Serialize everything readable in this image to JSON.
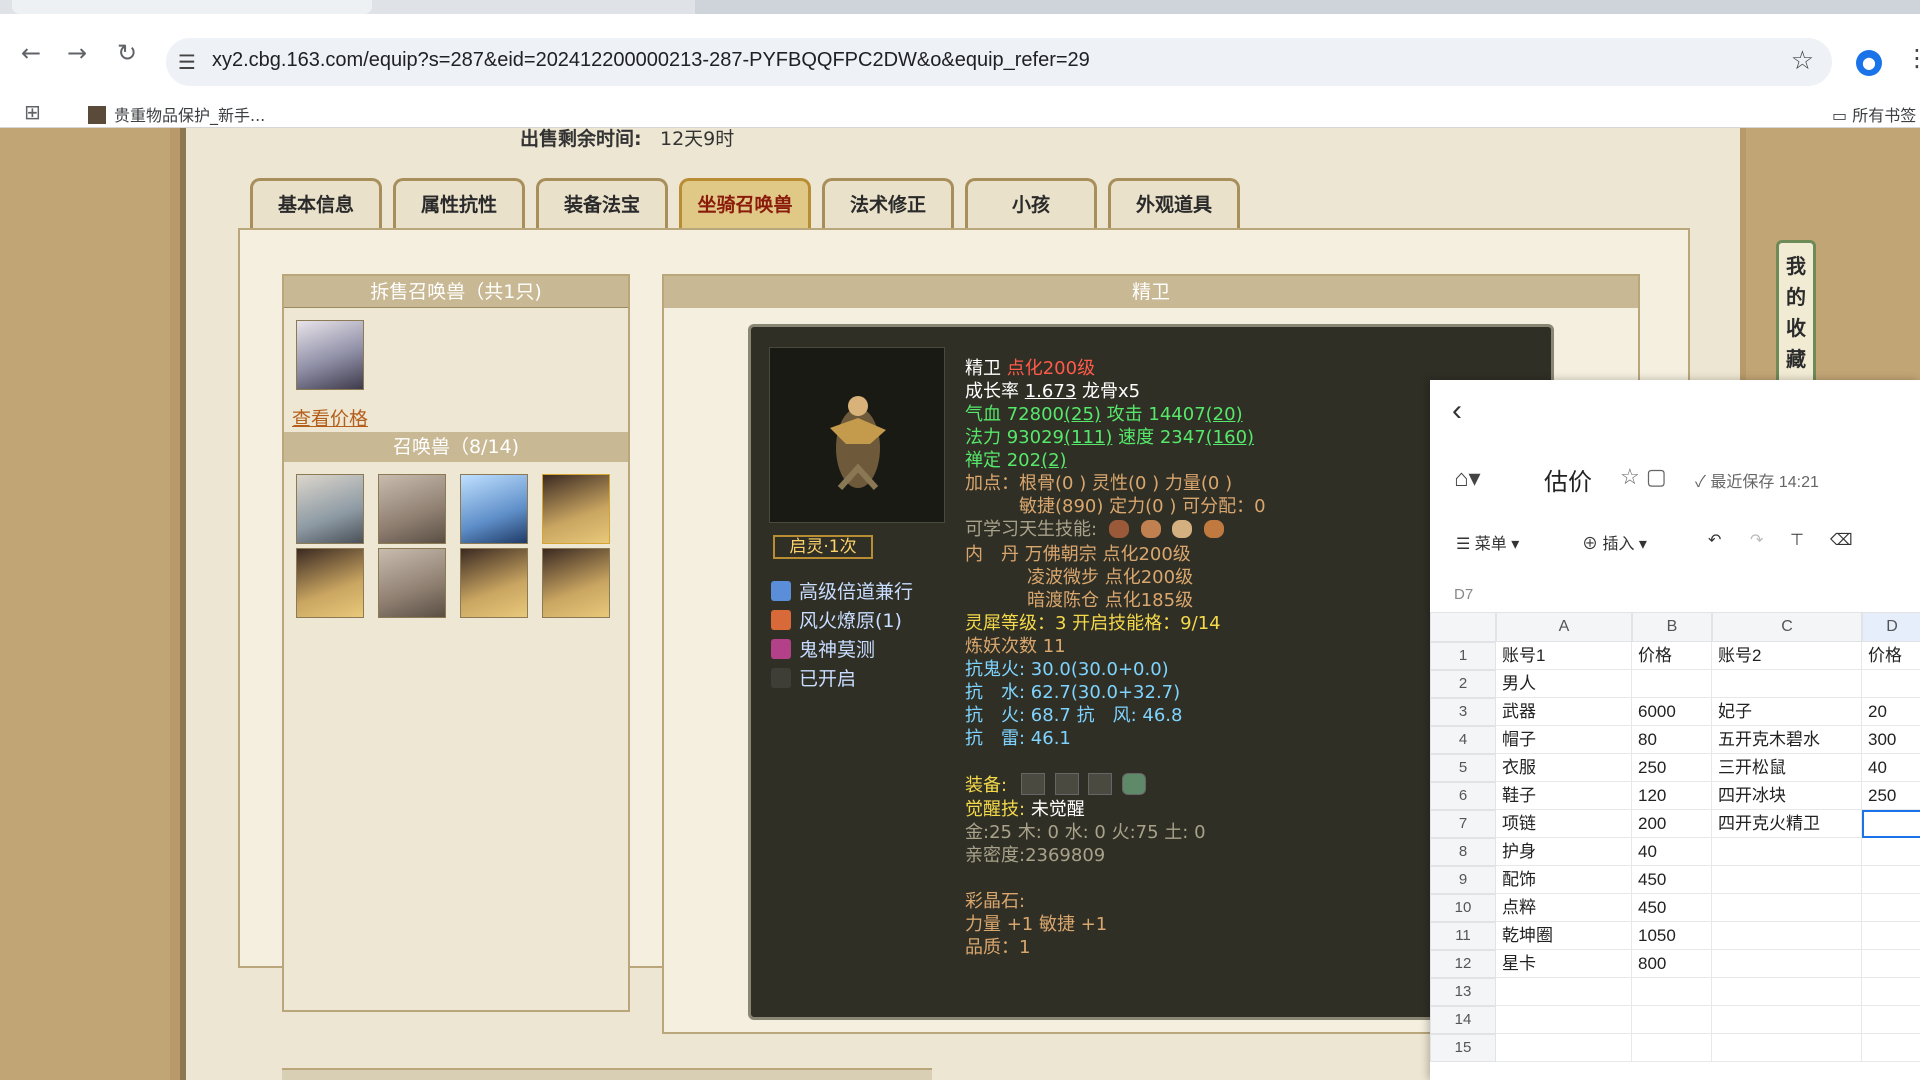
{
  "browser": {
    "url": "xy2.cbg.163.com/equip?s=287&eid=202412200000213-287-PYFBQQFPC2DW&o&equip_refer=29",
    "bookmark_1": "贵重物品保护_新手...",
    "bookmark_all": "所有书签"
  },
  "page": {
    "sale_label": "出售剩余时间:",
    "sale_value": "12天9时",
    "tabs": [
      "基本信息",
      "属性抗性",
      "装备法宝",
      "坐骑召唤兽",
      "法术修正",
      "小孩",
      "外观道具"
    ],
    "active_tab": 3,
    "split_pets_header": "拆售召唤兽（共1只)",
    "view_price": "查看价格",
    "pets_header": "召唤兽（8/14)",
    "detail_header": "精卫",
    "fav_strip": [
      "我",
      "的",
      "收",
      "藏"
    ]
  },
  "pet": {
    "qiling": "启灵·1次",
    "skills": [
      "高级倍道兼行",
      "风火燎原(1)",
      "鬼神莫测",
      "已开启"
    ],
    "name": "精卫",
    "level": "点化200级",
    "growth_label": "成长率",
    "growth": "1.673",
    "longgu": "龙骨x5",
    "hp": "气血 72800",
    "hp_bonus": "(25)",
    "atk": "攻击 14407",
    "atk_bonus": "(20)",
    "mp": "法力 93029",
    "mp_bonus": "(111)",
    "spd": "速度 2347",
    "spd_bonus": "(160)",
    "chanding": "禅定 202",
    "chanding_bonus": "(2)",
    "points1": "加点：根骨(0 ) 灵性(0 ) 力量(0 )",
    "points2": "敏捷(890) 定力(0 ) 可分配：0",
    "learnable": "可学习天生技能:",
    "neidan1_label": "内　丹",
    "neidan1": "万佛朝宗 点化200级",
    "neidan2": "凌波微步 点化200级",
    "neidan3": "暗渡陈仓 点化185级",
    "lingxi": "灵犀等级：3 开启技能格：9/14",
    "lianyao": "炼妖次数 11",
    "res_guihuo": "抗鬼火: 30.0(30.0+0.0)",
    "res_shui": "抗　水: 62.7(30.0+32.7)",
    "res_huo_feng": "抗　火: 68.7 抗　风: 46.8",
    "res_lei": "抗　雷: 46.1",
    "equip_label": "装备:",
    "awaken_label": "觉醒技:",
    "awaken_value": "未觉醒",
    "elements": "金:25 木: 0 水: 0 火:75 土: 0",
    "intimacy": "亲密度:2369809",
    "crystal_label": "彩晶石:",
    "crystal_stats": "力量 +1 敏捷 +1",
    "quality": "品质：1"
  },
  "sheet": {
    "title": "估价",
    "saved": "最近保存 14:21",
    "menu": "菜单",
    "insert": "插入",
    "cellref": "D7",
    "columns": [
      "A",
      "B",
      "C",
      "D"
    ],
    "rows": [
      [
        "1",
        "账号1",
        "价格",
        "账号2",
        "价格"
      ],
      [
        "2",
        "男人",
        "",
        "",
        ""
      ],
      [
        "3",
        "武器",
        "6000",
        "妃子",
        "20"
      ],
      [
        "4",
        "帽子",
        "80",
        "五开克木碧水",
        "300"
      ],
      [
        "5",
        "衣服",
        "250",
        "三开松鼠",
        "40"
      ],
      [
        "6",
        "鞋子",
        "120",
        "四开冰块",
        "250"
      ],
      [
        "7",
        "项链",
        "200",
        "四开克火精卫",
        ""
      ],
      [
        "8",
        "护身",
        "40",
        "",
        ""
      ],
      [
        "9",
        "配饰",
        "450",
        "",
        ""
      ],
      [
        "10",
        "点粹",
        "450",
        "",
        ""
      ],
      [
        "11",
        "乾坤圈",
        "1050",
        "",
        ""
      ],
      [
        "12",
        "星卡",
        "800",
        "",
        ""
      ],
      [
        "13",
        "",
        "",
        "",
        ""
      ],
      [
        "14",
        "",
        "",
        "",
        ""
      ],
      [
        "15",
        "",
        "",
        "",
        ""
      ]
    ]
  }
}
